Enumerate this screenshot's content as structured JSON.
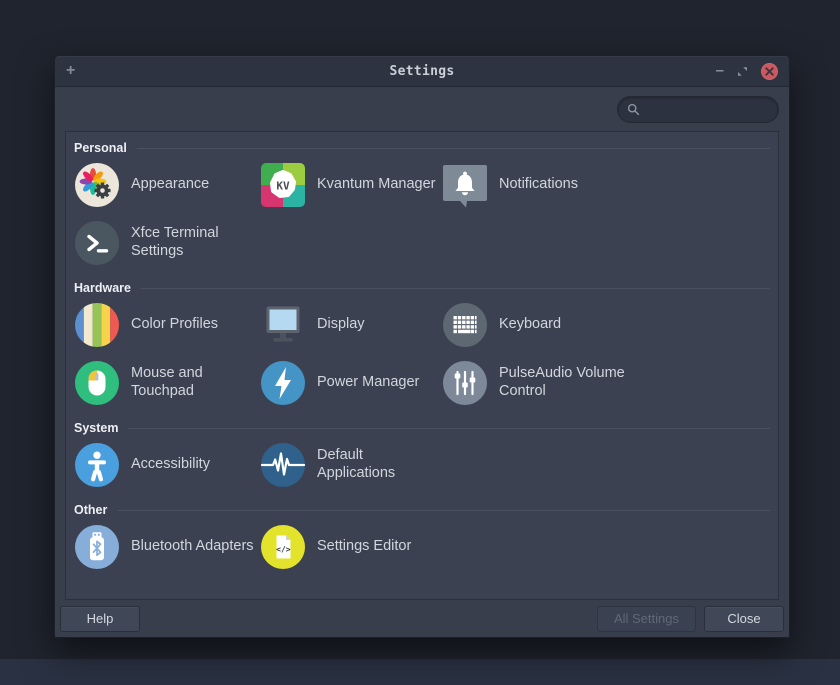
{
  "titlebar": {
    "title": "Settings",
    "plus": "+",
    "minimize": "–"
  },
  "search": {
    "value": "",
    "placeholder": ""
  },
  "sections": {
    "personal": {
      "label": "Personal",
      "items": [
        {
          "label": "Appearance",
          "icon": "appearance-icon"
        },
        {
          "label": "Kvantum Manager",
          "icon": "kvantum-manager-icon"
        },
        {
          "label": "Notifications",
          "icon": "notifications-icon"
        },
        {
          "label": "Xfce Terminal Settings",
          "icon": "terminal-icon"
        }
      ]
    },
    "hardware": {
      "label": "Hardware",
      "items": [
        {
          "label": "Color Profiles",
          "icon": "color-profiles-icon"
        },
        {
          "label": "Display",
          "icon": "display-icon"
        },
        {
          "label": "Keyboard",
          "icon": "keyboard-icon"
        },
        {
          "label": "Mouse and Touchpad",
          "icon": "mouse-icon"
        },
        {
          "label": "Power Manager",
          "icon": "power-manager-icon"
        },
        {
          "label": "PulseAudio Volume Control",
          "icon": "pulseaudio-icon"
        }
      ]
    },
    "system": {
      "label": "System",
      "items": [
        {
          "label": "Accessibility",
          "icon": "accessibility-icon"
        },
        {
          "label": "Default Applications",
          "icon": "default-applications-icon"
        }
      ]
    },
    "other": {
      "label": "Other",
      "items": [
        {
          "label": "Bluetooth Adapters",
          "icon": "bluetooth-icon"
        },
        {
          "label": "Settings Editor",
          "icon": "settings-editor-icon"
        }
      ]
    }
  },
  "footer": {
    "help": "Help",
    "all_settings": "All Settings",
    "close": "Close"
  },
  "colors": {
    "close_button": "#cb575f",
    "window_bg": "#383e4c",
    "titlebar_bg": "#2d3340",
    "content_bg": "#3b4150",
    "desktop_bg": "#20242e"
  }
}
